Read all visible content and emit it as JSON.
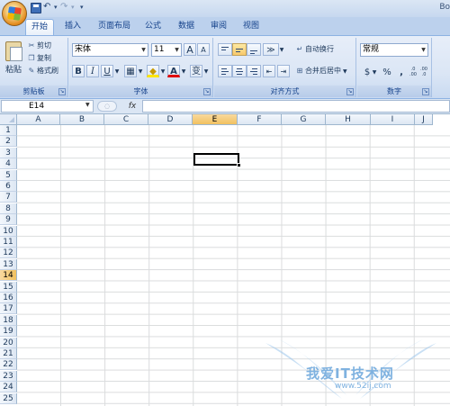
{
  "titlebar": {
    "text": "Bo"
  },
  "qat": {
    "undo": "↶",
    "redo": "↷",
    "dropdown": "▾",
    "customize": "▾"
  },
  "tabs": [
    "开始",
    "插入",
    "页面布局",
    "公式",
    "数据",
    "审阅",
    "视图"
  ],
  "ribbon": {
    "clipboard": {
      "label": "剪贴板",
      "paste": "粘贴",
      "cut": "剪切",
      "copy": "复制",
      "format_painter": "格式刷"
    },
    "font": {
      "label": "字体",
      "name": "宋体",
      "size": "11",
      "grow": "A",
      "shrink": "A",
      "bold": "B",
      "italic": "I",
      "underline": "U",
      "border": "▦",
      "fill": "◆",
      "color": "A",
      "phonetic": "变"
    },
    "alignment": {
      "label": "对齐方式",
      "wrap": "自动换行",
      "merge": "合并后居中",
      "orientation": "≫"
    },
    "number": {
      "label": "数字",
      "format": "常规",
      "currency": "$",
      "percent": "%",
      "comma": ",",
      "inc_dec": ".0 .00",
      "dec_dec": ".00 .0"
    }
  },
  "formula_bar": {
    "name_box": "E14",
    "fx": "fx",
    "value": ""
  },
  "grid": {
    "columns": [
      "A",
      "B",
      "C",
      "D",
      "E",
      "F",
      "G",
      "H",
      "I",
      "J"
    ],
    "rows": [
      "1",
      "2",
      "3",
      "4",
      "5",
      "6",
      "7",
      "8",
      "9",
      "10",
      "11",
      "12",
      "13",
      "14",
      "15",
      "16",
      "17",
      "18",
      "19",
      "20",
      "21",
      "22",
      "23",
      "24",
      "25"
    ],
    "selected_column": "E",
    "selected_row": "14"
  },
  "watermark": {
    "text": "我爱IT技术网",
    "url": "www.52ij.com"
  },
  "colors": {
    "ribbon_bg": "#dbe6f5",
    "tab_text": "#15428b",
    "selected_header": "#f1c15f",
    "gridline": "#dadcdd"
  }
}
